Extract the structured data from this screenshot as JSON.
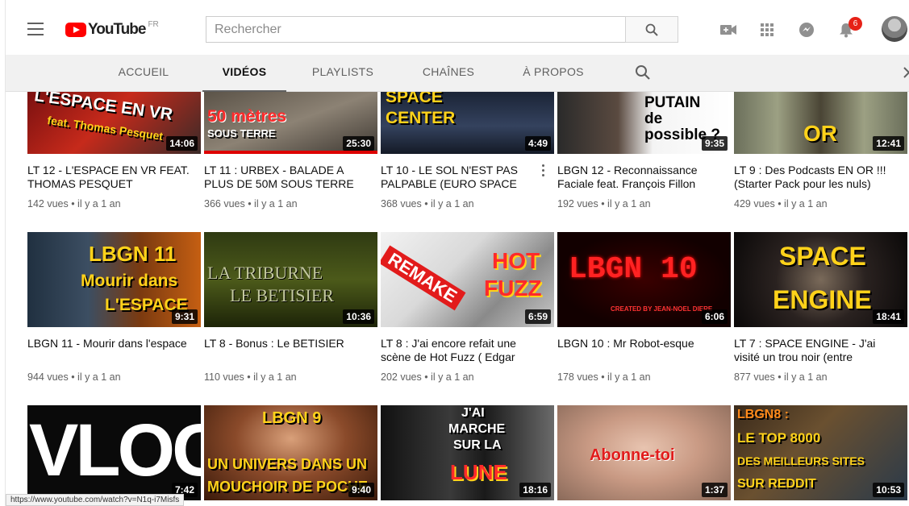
{
  "masthead": {
    "logo_text": "YouTube",
    "logo_region": "FR",
    "search_placeholder": "Rechercher",
    "notification_count": "6",
    "icons": [
      "hamburger-icon",
      "search-icon",
      "video-camera-plus-icon",
      "apps-grid-icon",
      "messages-icon",
      "bell-icon",
      "avatar"
    ]
  },
  "tabs": [
    {
      "label": "ACCUEIL",
      "active": false
    },
    {
      "label": "VIDÉOS",
      "active": true
    },
    {
      "label": "PLAYLISTS",
      "active": false
    },
    {
      "label": "CHAÎNES",
      "active": false
    },
    {
      "label": "À PROPOS",
      "active": false
    }
  ],
  "videos": [
    {
      "title": "LT 12 - L'ESPACE EN VR FEAT. THOMAS PESQUET",
      "meta": "142 vues • il y a 1 an",
      "duration": "14:06",
      "thumb_text": [
        "L'ESPACE EN VR",
        "feat. Thomas Pesquet"
      ]
    },
    {
      "title": "LT 11 : URBEX - BALADE A PLUS DE 50M SOUS TERRE",
      "meta": "366 vues • il y a 1 an",
      "duration": "25:30",
      "thumb_text": [
        "50 mètres",
        "SOUS TERRE"
      ]
    },
    {
      "title": "LT 10 - LE SOL N'EST PAS PALPABLE (EURO SPACE",
      "meta": "368 vues • il y a 1 an",
      "duration": "4:49",
      "thumb_text": [
        "SPACE",
        "CENTER"
      ]
    },
    {
      "title": "LBGN 12 - Reconnaissance Faciale feat. François Fillon",
      "meta": "192 vues • il y a 1 an",
      "duration": "9:35",
      "thumb_text": [
        "PUTAIN",
        "de",
        "possible ?"
      ]
    },
    {
      "title": "LT 9 : Des Podcasts EN OR !!! (Starter Pack pour les nuls)",
      "meta": "429 vues • il y a 1 an",
      "duration": "12:41",
      "thumb_text": [
        "OR"
      ]
    },
    {
      "title": "LBGN 11 - Mourir dans l'espace",
      "meta": "944 vues • il y a 1 an",
      "duration": "9:31",
      "thumb_text": [
        "LBGN 11",
        "Mourir dans",
        "L'ESPACE"
      ]
    },
    {
      "title": "LT 8 - Bonus : Le BETISIER",
      "meta": "110 vues • il y a 1 an",
      "duration": "10:36",
      "thumb_text": [
        "LA TRIBURNE",
        "LE BETISIER"
      ]
    },
    {
      "title": "LT 8 : J'ai encore refait une scène de Hot Fuzz ( Edgar",
      "meta": "202 vues • il y a 1 an",
      "duration": "6:59",
      "thumb_text": [
        "REMAKE",
        "HOT",
        "FUZZ"
      ]
    },
    {
      "title": "LBGN 10 : Mr Robot-esque",
      "meta": "178 vues • il y a 1 an",
      "duration": "6:06",
      "thumb_text": [
        "LBGN 10",
        "CREATED BY JEAN-NOEL DIERE"
      ]
    },
    {
      "title": "LT 7 : SPACE ENGINE - J'ai visité un trou noir (entre",
      "meta": "877 vues • il y a 1 an",
      "duration": "18:41",
      "thumb_text": [
        "SPACE",
        "ENGINE"
      ]
    },
    {
      "title": "",
      "meta": "",
      "duration": "7:42",
      "thumb_text": [
        "VLOG"
      ]
    },
    {
      "title": "",
      "meta": "",
      "duration": "9:40",
      "thumb_text": [
        "LBGN 9",
        "UN UNIVERS DANS UN",
        "MOUCHOIR DE POCHE"
      ]
    },
    {
      "title": "",
      "meta": "",
      "duration": "18:16",
      "thumb_text": [
        "J'AI",
        "MARCHE",
        "SUR LA",
        "LUNE"
      ]
    },
    {
      "title": "",
      "meta": "",
      "duration": "1:37",
      "thumb_text": [
        "Abonne-toi"
      ]
    },
    {
      "title": "",
      "meta": "",
      "duration": "10:53",
      "thumb_text": [
        "LBGN8 :",
        "LE TOP 8000",
        "DES MEILLEURS SITES",
        "SUR REDDIT"
      ]
    }
  ],
  "status_url": "https://www.youtube.com/watch?v=N1q-i7Misfs",
  "colors": {
    "brand": "#ff0000",
    "badge": "#e62117",
    "tab_bg": "#f1f1f1"
  }
}
